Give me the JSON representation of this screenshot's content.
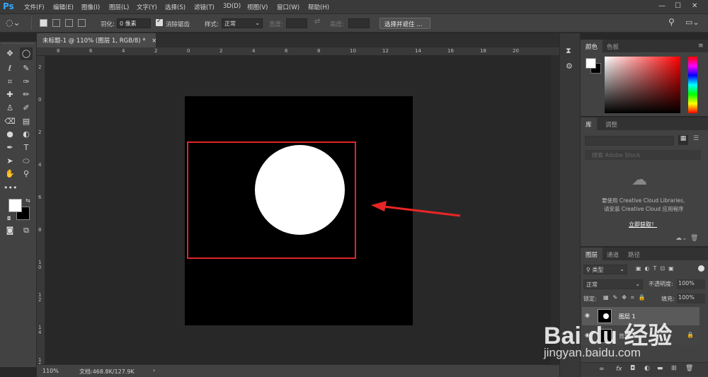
{
  "app": {
    "logo": "Ps"
  },
  "menu": {
    "items": [
      "文件(F)",
      "编辑(E)",
      "图像(I)",
      "图层(L)",
      "文字(Y)",
      "选择(S)",
      "滤镜(T)",
      "3D(D)",
      "视图(V)",
      "窗口(W)",
      "帮助(H)"
    ]
  },
  "window_controls": {
    "minimize": "—",
    "maximize": "☐",
    "close": "✕"
  },
  "options": {
    "feather_label": "羽化:",
    "feather_value": "0 像素",
    "antialias_label": "消除锯齿",
    "style_label": "样式:",
    "style_value": "正常",
    "width_label": "宽度:",
    "height_label": "高度:",
    "select_mask_button": "选择并遮住 ..."
  },
  "document": {
    "tab_title": "未标题-1 @ 110% (图层 1, RGB/8) *",
    "tab_close": "×"
  },
  "rulers": {
    "h_labels": [
      "8",
      "6",
      "4",
      "2",
      "0",
      "2",
      "4",
      "6",
      "8",
      "10",
      "12",
      "14",
      "16",
      "18",
      "20"
    ],
    "v_labels": [
      "2",
      "0",
      "2",
      "4",
      "6",
      "8",
      "1 0",
      "1 2",
      "1 4",
      "1 6"
    ]
  },
  "status": {
    "zoom": "110%",
    "doc_info": "文档:468.8K/127.9K",
    "arrow": "›"
  },
  "color_panel": {
    "tabs": [
      "颜色",
      "色板"
    ],
    "accent": "#ff0000"
  },
  "library_panel": {
    "tabs": [
      "库",
      "调整"
    ],
    "search_placeholder": "搜索 Adobe Stock",
    "message_line1": "要使用 Creative Cloud Libraries,",
    "message_line2": "请安装 Creative Cloud 应用程序",
    "link": "立即获取！"
  },
  "layers_panel": {
    "tabs": [
      "图层",
      "通道",
      "路径"
    ],
    "filter_label": "类型",
    "blend_mode": "正常",
    "opacity_label": "不透明度:",
    "opacity_value": "100%",
    "lock_label": "锁定:",
    "fill_label": "填充:",
    "fill_value": "100%",
    "layers": [
      {
        "name": "图层 1",
        "selected": true
      },
      {
        "name": "背景",
        "selected": false
      }
    ],
    "footer_fx": "fx"
  },
  "watermark": {
    "brand": "Bai du 经验",
    "url": "jingyan.baidu.com"
  }
}
